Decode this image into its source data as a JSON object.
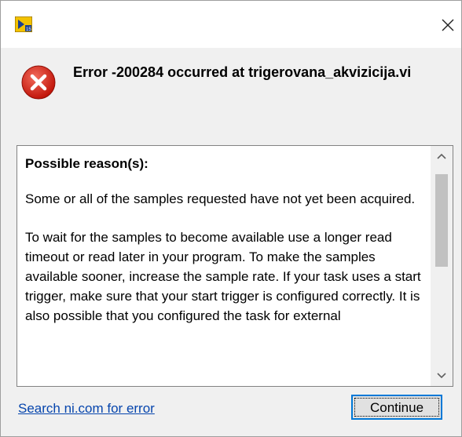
{
  "dialog": {
    "title_icon": "labview-app-icon",
    "close_icon": "close-icon",
    "error_icon": "error-icon",
    "error_title": "Error -200284 occurred at trigerovana_akvizicija.vi"
  },
  "details": {
    "heading": "Possible reason(s):",
    "paragraphs": [
      "Some or all of the samples requested have not yet been acquired.",
      "To wait for the samples to become available use a longer read timeout or read later in your program. To make the samples available sooner, increase the sample rate. If your task uses a start trigger,  make sure that your start trigger is configured correctly. It is also possible that you configured the task for external"
    ]
  },
  "footer": {
    "search_link": "Search ni.com for error",
    "continue_label": "Continue"
  },
  "colors": {
    "error_red": "#d9291c",
    "link_blue": "#0645ad",
    "focus_blue": "#0078d7"
  }
}
